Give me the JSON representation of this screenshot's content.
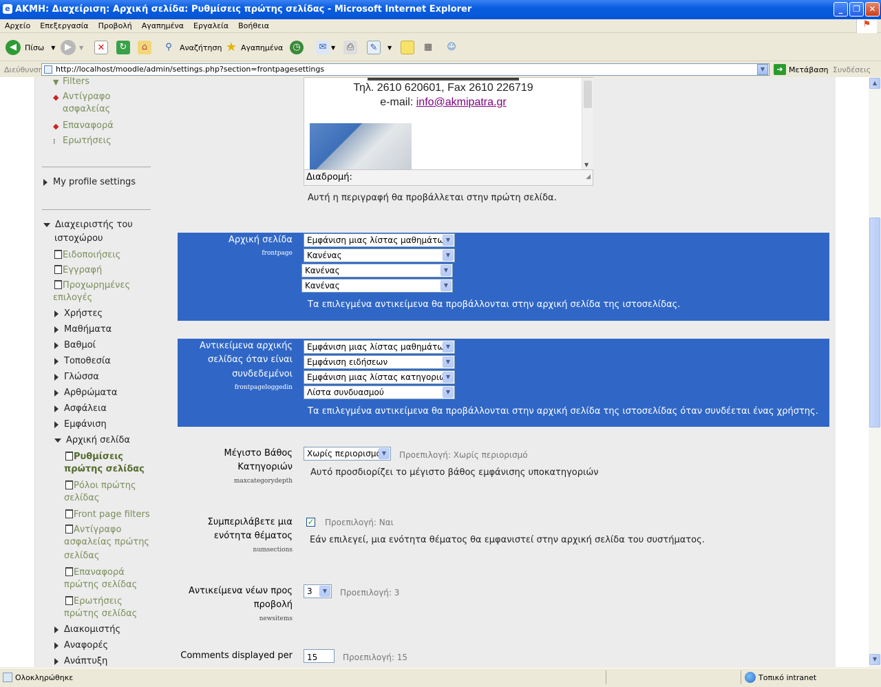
{
  "window": {
    "title": "ΑΚΜΗ: Διαχείριση: Αρχική σελίδα: Ρυθμίσεις πρώτης σελίδας - Microsoft Internet Explorer"
  },
  "menu": [
    "Αρχείο",
    "Επεξεργασία",
    "Προβολή",
    "Αγαπημένα",
    "Εργαλεία",
    "Βοήθεια"
  ],
  "toolbar": {
    "back_label": "Πίσω",
    "search_label": "Αναζήτηση",
    "favorites_label": "Αγαπημένα"
  },
  "address": {
    "label": "Διεύθυνση",
    "url": "http://localhost/moodle/admin/settings.php?section=frontpagesettings",
    "go_label": "Μετάβαση",
    "links_label": "Συνδέσεις"
  },
  "sidebar": {
    "filters": "Filters",
    "backup": "Αντίγραφο ασφαλείας",
    "restore": "Επαναφορά",
    "questions": "Ερωτήσεις",
    "my_profile": "My profile settings",
    "site_admin_line1": "Διαχειριστής του",
    "site_admin_line2": "ιστοχώρου",
    "notifications": "Ειδοποιήσεις",
    "registration": "Εγγραφή",
    "advanced_line1": "Προχωρημένες",
    "advanced_line2": "επιλογές",
    "users": "Χρήστες",
    "courses": "Μαθήματα",
    "grades": "Βαθμοί",
    "location": "Τοποθεσία",
    "language": "Γλώσσα",
    "modules": "Αρθρώματα",
    "security": "Ασφάλεια",
    "appearance": "Εμφάνιση",
    "frontpage": "Αρχική σελίδα",
    "fp_settings_line1": "Ρυθμίσεις",
    "fp_settings_line2": "πρώτης σελίδας",
    "fp_roles_line1": "Ρόλοι πρώτης",
    "fp_roles_line2": "σελίδας",
    "fp_filters": "Front page filters",
    "fp_backup_line1": "Αντίγραφο",
    "fp_backup_line2": "ασφαλείας πρώτης",
    "fp_backup_line3": "σελίδας",
    "fp_restore_line1": "Επαναφορά",
    "fp_restore_line2": "πρώτης σελίδας",
    "fp_questions_line1": "Ερωτήσεις",
    "fp_questions_line2": "πρώτης σελίδας",
    "server": "Διακομιστής",
    "reports": "Αναφορές",
    "development": "Ανάπτυξη"
  },
  "editor": {
    "line_phone": "Τηλ. 2610 620601, Fax 2610 226719",
    "line_email_prefix": "e-mail: ",
    "email": "info@akmipatra.gr",
    "path_label": "Διαδρομή:"
  },
  "summary_desc": "Αυτή η περιγραφή θα προβάλλεται στην πρώτη σελίδα.",
  "frontpage": {
    "label": "Αρχική σελίδα",
    "key": "frontpage",
    "selects": [
      "Εμφάνιση μιας λίστας μαθημάτων",
      "Κανένας",
      "Κανένας",
      "Κανένας"
    ],
    "desc": "Τα επιλεγμένα αντικείμενα θα προβάλλονται στην αρχική σελίδα της ιστοσελίδας."
  },
  "frontpageloggedin": {
    "label_line1": "Αντικείμενα αρχικής",
    "label_line2": "σελίδας όταν είναι",
    "label_line3": "συνδεδεμένοι",
    "key": "frontpageloggedin",
    "selects": [
      "Εμφάνιση μιας λίστας μαθημάτων",
      "Εμφάνιση ειδήσεων",
      "Εμφάνιση μιας λίστας κατηγοριών",
      "Λίστα συνδυασμού"
    ],
    "desc": "Τα επιλεγμένα αντικείμενα θα προβάλλονται στην αρχική σελίδα της ιστοσελίδας όταν συνδέεται ένας χρήστης."
  },
  "maxcategorydepth": {
    "label_line1": "Μέγιστο Βάθος",
    "label_line2": "Κατηγοριών",
    "key": "maxcategorydepth",
    "value": "Χωρίς περιορισμό",
    "default": "Προεπιλογή: Χωρίς περιορισμό",
    "desc": "Αυτό προσδιορίζει το μέγιστο βάθος εμφάνισης υποκατηγοριών"
  },
  "numsections": {
    "label_line1": "Συμπεριλάβετε μια",
    "label_line2": "ενότητα θέματος",
    "key": "numsections",
    "checked": true,
    "check_glyph": "✓",
    "default": "Προεπιλογή: Ναι",
    "desc": "Εάν επιλεγεί, μια ενότητα θέματος θα εμφανιστεί στην αρχική σελίδα του συστήματος."
  },
  "newsitems": {
    "label_line1": "Αντικείμενα νέων προς",
    "label_line2": "προβολή",
    "key": "newsitems",
    "value": "3",
    "default": "Προεπιλογή: 3"
  },
  "comments": {
    "label": "Comments displayed per",
    "value": "15",
    "default": "Προεπιλογή: 15"
  },
  "status": {
    "done": "Ολοκληρώθηκε",
    "zone": "Τοπικό intranet"
  }
}
